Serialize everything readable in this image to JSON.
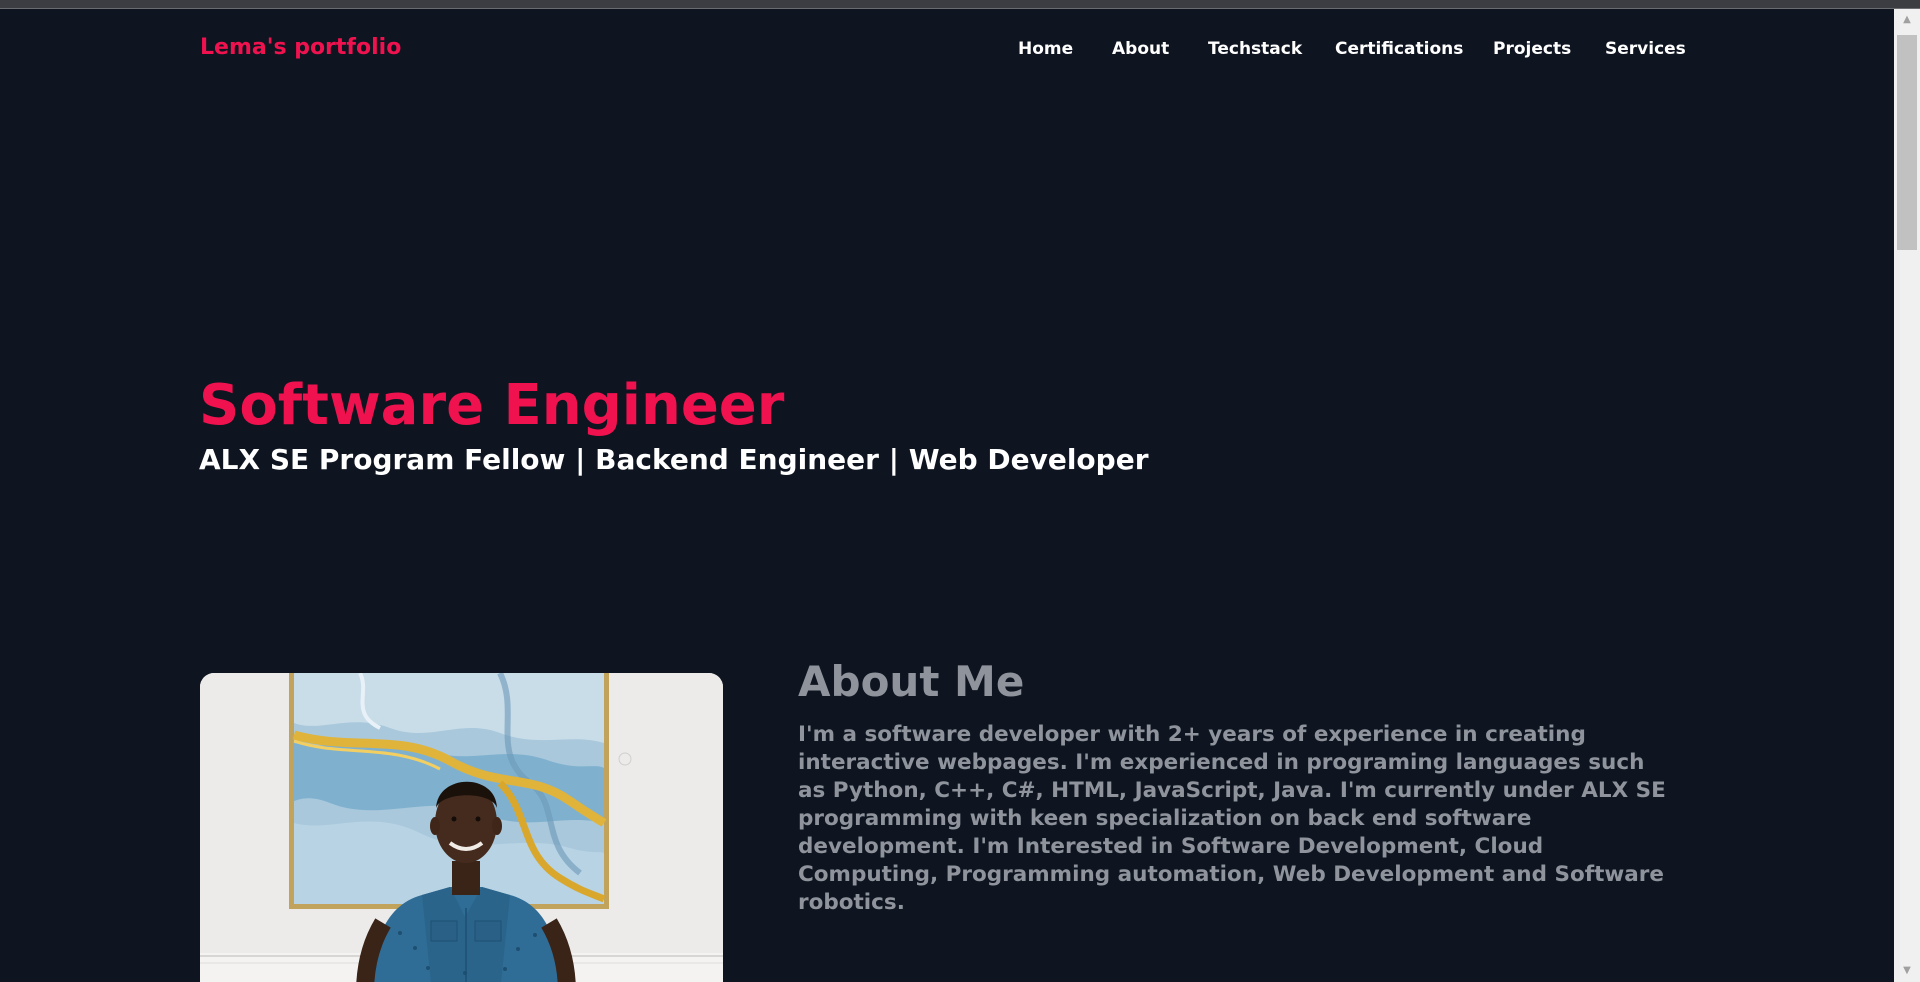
{
  "brand": "Lema's portfolio",
  "nav": {
    "items": [
      {
        "label": "Home"
      },
      {
        "label": "About"
      },
      {
        "label": "Techstack"
      },
      {
        "label": "Certifications"
      },
      {
        "label": "Projects"
      },
      {
        "label": "Services"
      }
    ]
  },
  "hero": {
    "title": "Software Engineer",
    "subtitle": "ALX SE Program Fellow | Backend Engineer | Web Developer"
  },
  "about": {
    "title": "About Me",
    "text": "I'm a software developer with 2+ years of experience in creating interactive webpages. I'm experienced in programing languages such as Python, C++, C#, HTML, JavaScript, Java. I'm currently under ALX SE programming with keen specialization on back end software development. I'm Interested in Software Development, Cloud Computing, Programming automation, Web Development and Software robotics."
  },
  "colors": {
    "background": "#0e1420",
    "accent": "#f0124f",
    "muted_text": "#8f949c"
  },
  "icons": {
    "scroll_up": "scroll-up-arrow-icon",
    "scroll_down": "scroll-down-arrow-icon"
  }
}
